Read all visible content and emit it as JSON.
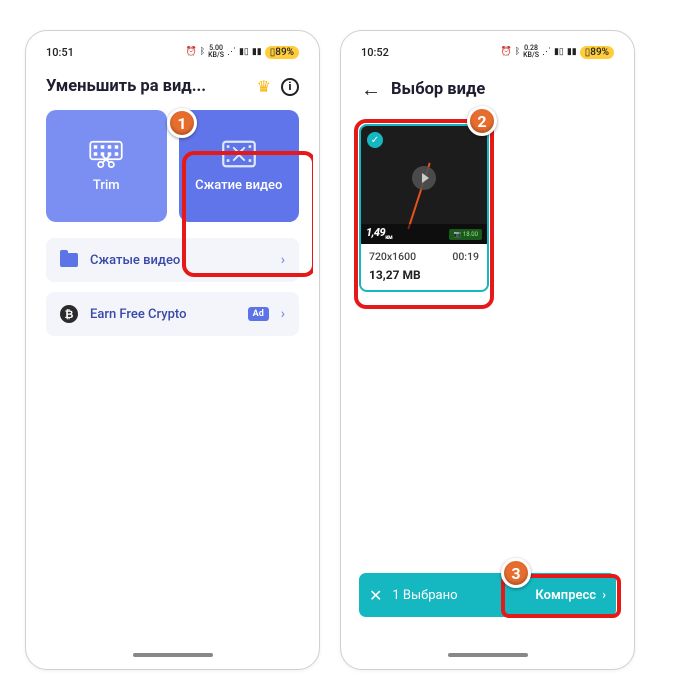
{
  "left": {
    "status": {
      "time": "10:51",
      "net": "5.00",
      "net_unit": "KB/S",
      "battery": "89%"
    },
    "title": "Уменьшить ра        вид...",
    "tiles": {
      "trim": "Trim",
      "compress": "Сжатие видео"
    },
    "rows": {
      "compressed": "Сжатые видео",
      "crypto": "Earn Free Crypto",
      "ad": "Ad"
    }
  },
  "right": {
    "status": {
      "time": "10:52",
      "net": "0.28",
      "net_unit": "KB/S",
      "battery": "89%"
    },
    "title": "Выбор виде",
    "video": {
      "speed": "1,49",
      "gps": "18.00",
      "resolution": "720x1600",
      "duration": "00:19",
      "size": "13,27 MB"
    },
    "bar": {
      "selected": "1 Выбрано",
      "compress": "Компресс"
    }
  },
  "steps": {
    "s1": "1",
    "s2": "2",
    "s3": "3"
  }
}
